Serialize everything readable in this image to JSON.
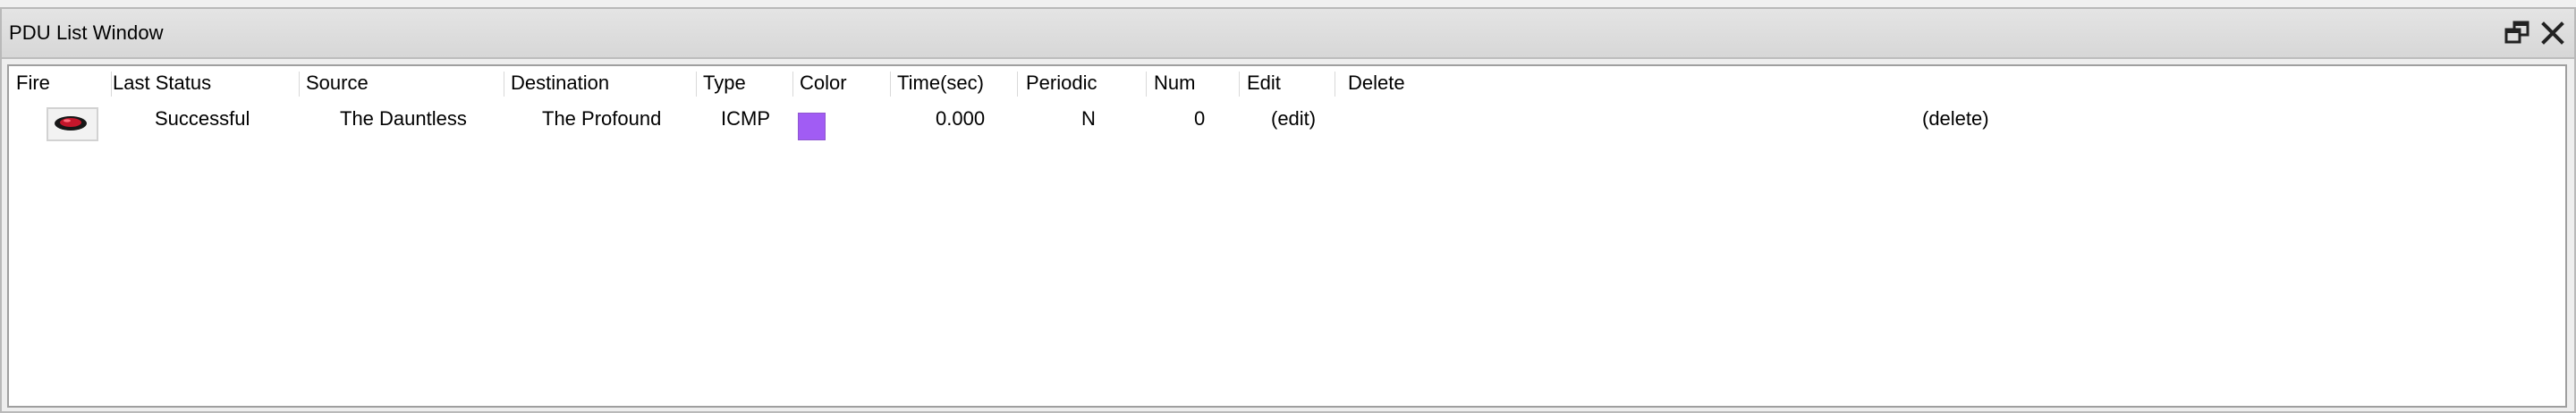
{
  "window": {
    "title": "PDU List Window",
    "restore_icon": "restore-window-icon",
    "close_icon": "close-icon"
  },
  "table": {
    "columns": [
      "Fire",
      "Last Status",
      "Source",
      "Destination",
      "Type",
      "Color",
      "Time(sec)",
      "Periodic",
      "Num",
      "Edit",
      "Delete"
    ],
    "rows": [
      {
        "fire_icon": "fire-icon",
        "last_status": "Successful",
        "source": "The Dauntless",
        "destination": "The Profound",
        "type": "ICMP",
        "color": "#a15cf4",
        "time_sec": "0.000",
        "periodic": "N",
        "num": "0",
        "edit": "(edit)",
        "delete": "(delete)"
      }
    ]
  }
}
